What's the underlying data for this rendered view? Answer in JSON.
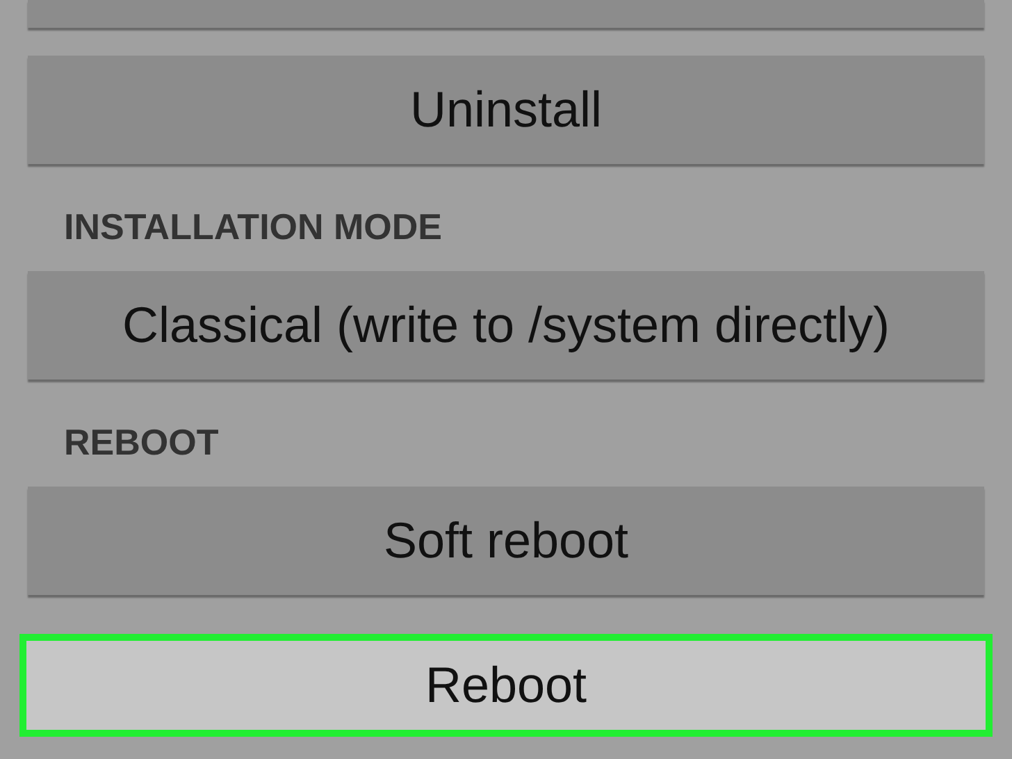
{
  "items": [
    {
      "kind": "button",
      "selected": false
    },
    {
      "kind": "button",
      "label": "Uninstall",
      "selected": false
    },
    {
      "kind": "header",
      "label": "INSTALLATION MODE"
    },
    {
      "kind": "button",
      "label": "Classical (write to /system directly)",
      "selected": false
    },
    {
      "kind": "header",
      "label": "REBOOT"
    },
    {
      "kind": "button",
      "label": "Soft reboot",
      "selected": false
    },
    {
      "kind": "button",
      "label": "Reboot",
      "selected": true
    }
  ]
}
